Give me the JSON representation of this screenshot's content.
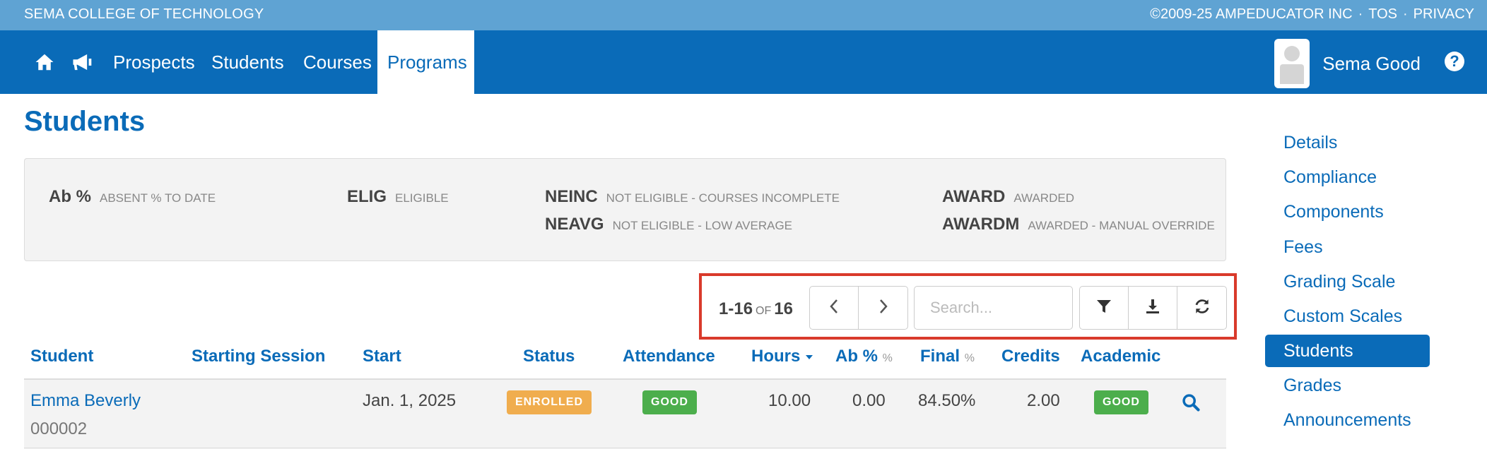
{
  "topbar": {
    "org": "SEMA COLLEGE OF TECHNOLOGY",
    "copyright": "©2009-25 AMPEDUCATOR INC",
    "sep": "·",
    "tos": "TOS",
    "privacy": "PRIVACY"
  },
  "nav": {
    "items": [
      "Prospects",
      "Students",
      "Courses",
      "Programs"
    ],
    "active": "Programs",
    "user_name": "Sema Good",
    "help": "?"
  },
  "page_title": "Students",
  "legend": [
    {
      "code": "Ab %",
      "desc": "ABSENT % TO DATE"
    },
    {
      "code": "ELIG",
      "desc": "ELIGIBLE"
    },
    {
      "code": "NEINC",
      "desc": "NOT ELIGIBLE - COURSES INCOMPLETE"
    },
    {
      "code": "NEAVG",
      "desc": "NOT ELIGIBLE - LOW AVERAGE"
    },
    {
      "code": "AWARD",
      "desc": "AWARDED"
    },
    {
      "code": "AWARDM",
      "desc": "AWARDED - MANUAL OVERRIDE"
    }
  ],
  "pager": {
    "range": "1-16",
    "of": "OF",
    "total": "16"
  },
  "search": {
    "placeholder": "Search..."
  },
  "table": {
    "headers": {
      "student": "Student",
      "starting_session": "Starting Session",
      "start": "Start",
      "status": "Status",
      "attendance": "Attendance",
      "hours": "Hours",
      "ab": "Ab %",
      "ab_unit": "%",
      "final": "Final",
      "final_unit": "%",
      "credits": "Credits",
      "academic": "Academic"
    },
    "rows": [
      {
        "name": "Emma Beverly",
        "id": "000002",
        "starting_session": "",
        "start": "Jan. 1, 2025",
        "status": "ENROLLED",
        "attendance": "GOOD",
        "hours": "10.00",
        "ab": "0.00",
        "final": "84.50%",
        "credits": "2.00",
        "academic": "GOOD"
      }
    ]
  },
  "sidebar": {
    "items": [
      "Details",
      "Compliance",
      "Components",
      "Fees",
      "Grading Scale",
      "Custom Scales",
      "Students",
      "Grades",
      "Announcements"
    ],
    "active": "Students"
  },
  "colors": {
    "topbar": "#5fa3d3",
    "nav": "#0a6bb8",
    "highlight": "#d93a2b",
    "badge_enrolled": "#f0ad4e",
    "badge_good": "#4cae4c"
  },
  "icons": [
    "home-icon",
    "megaphone-icon",
    "chevron-left-icon",
    "chevron-right-icon",
    "filter-icon",
    "download-icon",
    "refresh-icon",
    "search-icon",
    "help-icon"
  ]
}
